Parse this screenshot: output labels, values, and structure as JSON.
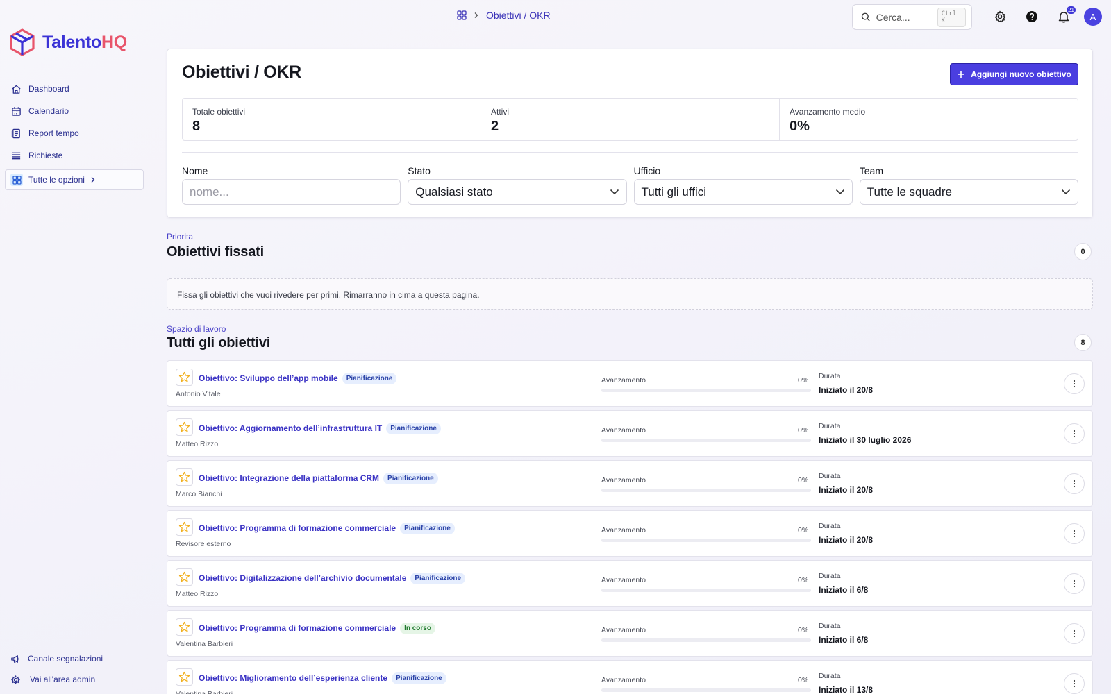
{
  "brand": {
    "part1": "Talento",
    "part2": "HQ"
  },
  "sidebar": {
    "items": [
      {
        "label": "Dashboard",
        "icon": "home-icon"
      },
      {
        "label": "Calendario",
        "icon": "calendar-icon"
      },
      {
        "label": "Report tempo",
        "icon": "report-icon"
      },
      {
        "label": "Richieste",
        "icon": "list-icon"
      }
    ],
    "all_options": "Tutte le opzioni",
    "bottom": [
      {
        "label": "Canale segnalazioni",
        "icon": "megaphone-icon"
      },
      {
        "label": "Vai all'area admin",
        "icon": "gear-icon"
      }
    ]
  },
  "topbar": {
    "breadcrumb": "Obiettivi / OKR",
    "search_placeholder": "Cerca...",
    "search_shortcut": "Ctrl K",
    "notifications_count": "21",
    "avatar_initial": "A"
  },
  "header": {
    "title": "Obiettivi / OKR",
    "add_button": "Aggiungi nuovo obiettivo",
    "stats": [
      {
        "label": "Totale obiettivi",
        "value": "8"
      },
      {
        "label": "Attivi",
        "value": "2"
      },
      {
        "label": "Avanzamento medio",
        "value": "0%"
      }
    ],
    "filters": {
      "name_label": "Nome",
      "name_placeholder": "nome...",
      "status_label": "Stato",
      "status_value": "Qualsiasi stato",
      "office_label": "Ufficio",
      "office_value": "Tutti gli uffici",
      "team_label": "Team",
      "team_value": "Tutte le squadre"
    }
  },
  "pinned": {
    "eyebrow": "Priorita",
    "title": "Obiettivi fissati",
    "count": "0",
    "empty_text": "Fissa gli obiettivi che vuoi rivedere per primi. Rimarranno in cima a questa pagina."
  },
  "all": {
    "eyebrow": "Spazio di lavoro",
    "title": "Tutti gli obiettivi",
    "count": "8",
    "progress_label": "Avanzamento",
    "duration_label": "Durata",
    "objectives": [
      {
        "title": "Obiettivo: Sviluppo dell’app mobile",
        "status": "Pianificazione",
        "status_type": "plan",
        "owner": "Antonio Vitale",
        "progress": 0,
        "progress_text": "0%",
        "duration": "Iniziato il 20/8"
      },
      {
        "title": "Obiettivo: Aggiornamento dell’infrastruttura IT",
        "status": "Pianificazione",
        "status_type": "plan",
        "owner": "Matteo Rizzo",
        "progress": 0,
        "progress_text": "0%",
        "duration": "Iniziato il 30 luglio 2026"
      },
      {
        "title": "Obiettivo: Integrazione della piattaforma CRM",
        "status": "Pianificazione",
        "status_type": "plan",
        "owner": "Marco Bianchi",
        "progress": 0,
        "progress_text": "0%",
        "duration": "Iniziato il 20/8"
      },
      {
        "title": "Obiettivo: Programma di formazione commerciale",
        "status": "Pianificazione",
        "status_type": "plan",
        "owner": "Revisore esterno",
        "progress": 0,
        "progress_text": "0%",
        "duration": "Iniziato il 20/8"
      },
      {
        "title": "Obiettivo: Digitalizzazione dell’archivio documentale",
        "status": "Pianificazione",
        "status_type": "plan",
        "owner": "Matteo Rizzo",
        "progress": 0,
        "progress_text": "0%",
        "duration": "Iniziato il 6/8"
      },
      {
        "title": "Obiettivo: Programma di formazione commerciale",
        "status": "In corso",
        "status_type": "prog",
        "owner": "Valentina Barbieri",
        "progress": 0,
        "progress_text": "0%",
        "duration": "Iniziato il 6/8"
      },
      {
        "title": "Obiettivo: Miglioramento dell’esperienza cliente",
        "status": "Pianificazione",
        "status_type": "plan",
        "owner": "Valentina Barbieri",
        "progress": 0,
        "progress_text": "0%",
        "duration": "Iniziato il 13/8"
      }
    ]
  },
  "colors": {
    "accent": "#4a3ee0",
    "link": "#3b33c4",
    "brand_red": "#e8556b",
    "star": "#f2b01e"
  }
}
